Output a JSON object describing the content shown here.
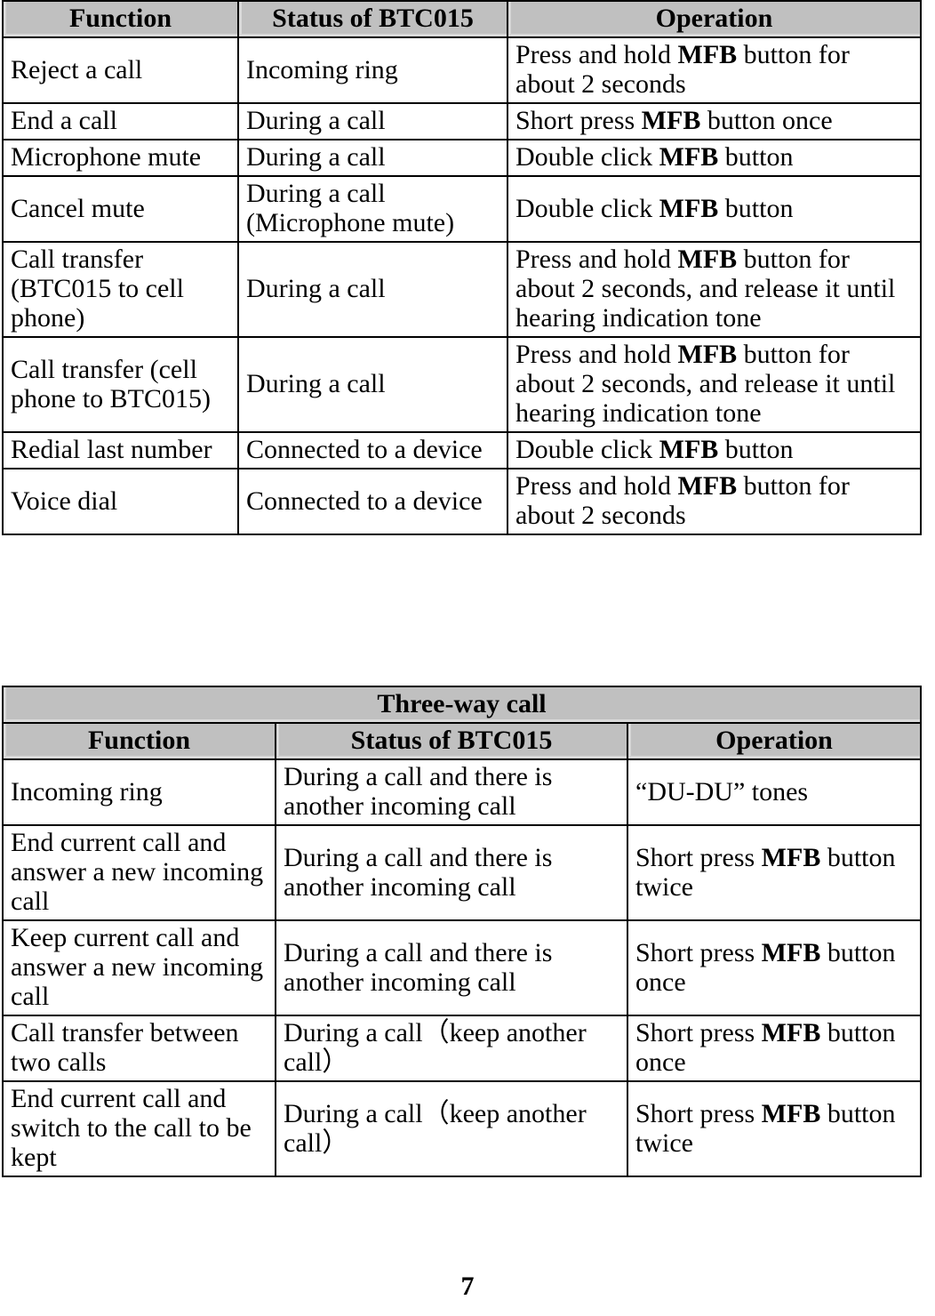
{
  "page": {
    "number": "7"
  },
  "tables": [
    {
      "id": "basic-call-functions",
      "title": null,
      "headers": [
        "Function",
        "Status of BTC015",
        "Operation"
      ],
      "rows": [
        {
          "function": "Reject a call",
          "status": "Incoming ring",
          "operation_pre": "Press and hold ",
          "operation_bold": "MFB",
          "operation_post": " button for about 2 seconds"
        },
        {
          "function": "End a call",
          "status": "During a call",
          "operation_pre": "Short press ",
          "operation_bold": "MFB",
          "operation_post": " button once"
        },
        {
          "function": "Microphone mute",
          "status": "During a call",
          "operation_pre": "Double click ",
          "operation_bold": "MFB",
          "operation_post": " button"
        },
        {
          "function": "Cancel mute",
          "status": "During a call (Microphone mute)",
          "operation_pre": "Double click ",
          "operation_bold": "MFB",
          "operation_post": " button"
        },
        {
          "function": "Call transfer (BTC015 to cell phone)",
          "status": "During a call",
          "operation_pre": "Press and hold ",
          "operation_bold": "MFB",
          "operation_post": " button for about 2 seconds, and release it until hearing indication tone"
        },
        {
          "function": "Call transfer (cell phone to BTC015)",
          "status": "During a call",
          "operation_pre": "Press and hold ",
          "operation_bold": "MFB",
          "operation_post": " button for about 2 seconds, and release it until hearing indication tone"
        },
        {
          "function": "Redial last number",
          "status": "Connected to a device",
          "operation_pre": "Double click ",
          "operation_bold": "MFB",
          "operation_post": " button"
        },
        {
          "function": "Voice dial",
          "status": "Connected to a device",
          "operation_pre": "Press and hold ",
          "operation_bold": "MFB",
          "operation_post": " button for about 2 seconds"
        }
      ]
    },
    {
      "id": "three-way-call",
      "title": "Three-way call",
      "headers": [
        "Function",
        "Status of BTC015",
        "Operation"
      ],
      "rows": [
        {
          "function": "Incoming ring",
          "status": "During a call and there is another incoming call",
          "operation_pre": "“DU-DU” tones",
          "operation_bold": "",
          "operation_post": ""
        },
        {
          "function": "End current call and answer a new incoming call",
          "status": "During a call and there is another incoming call",
          "operation_pre": "Short press ",
          "operation_bold": "MFB",
          "operation_post": " button twice"
        },
        {
          "function": "Keep current call and answer a new incoming call",
          "status": "During a call and there is another incoming call",
          "operation_pre": "Short press ",
          "operation_bold": "MFB",
          "operation_post": " button once"
        },
        {
          "function": "Call transfer between two calls",
          "status": "During a call（keep another call）",
          "operation_pre": "Short press ",
          "operation_bold": "MFB",
          "operation_post": " button once"
        },
        {
          "function": "End current call and switch to the call to be kept",
          "status": "During a call（keep another call）",
          "operation_pre": "Short press ",
          "operation_bold": "MFB",
          "operation_post": " button twice"
        }
      ]
    }
  ],
  "colors": {
    "header_background": "#c0c0c0",
    "header_highlight": "#d9d9d9",
    "border": "#000000",
    "text": "#000000",
    "page_background": "#ffffff"
  }
}
